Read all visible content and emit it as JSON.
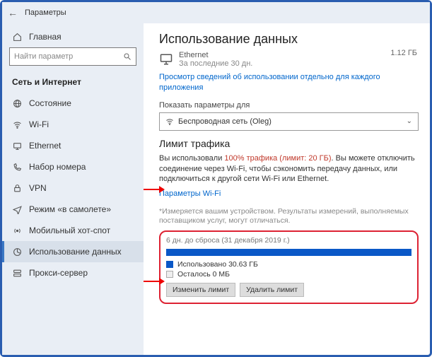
{
  "titlebar": {
    "label": "Параметры"
  },
  "sidebar": {
    "home": "Главная",
    "search_placeholder": "Найти параметр",
    "section": "Сеть и Интернет",
    "items": [
      {
        "label": "Состояние"
      },
      {
        "label": "Wi-Fi"
      },
      {
        "label": "Ethernet"
      },
      {
        "label": "Набор номера"
      },
      {
        "label": "VPN"
      },
      {
        "label": "Режим «в самолете»"
      },
      {
        "label": "Мобильный хот-спот"
      },
      {
        "label": "Использование данных"
      },
      {
        "label": "Прокси-сервер"
      }
    ]
  },
  "main": {
    "title": "Использование данных",
    "eth_name": "Ethernet",
    "eth_sub": "За последние 30 дн.",
    "total": "1.12 ГБ",
    "link_per_app": "Просмотр сведений об использовании отдельно для каждого приложения",
    "show_for": "Показать параметры для",
    "dropdown_value": "Беспроводная сеть (Oleg)",
    "limit_head": "Лимит трафика",
    "used_prefix": "Вы использовали ",
    "used_red": "100% трафика (лимит: 20 ГБ)",
    "used_suffix": ".  Вы можете отключить соединение через Wi-Fi, чтобы сэкономить передачу данных, или подключиться к другой сети Wi-Fi или Ethernet.",
    "wifi_params": "Параметры Wi-Fi",
    "footnote": "*Измеряется вашим устройством. Результаты измерений, выполняемых поставщиком услуг, могут отличаться.",
    "reset": "6 дн. до сброса (31 декабря 2019 г.)",
    "used_legend": "Использовано 30.63 ГБ",
    "left_legend": "Осталось 0 МБ",
    "btn_change": "Изменить лимит",
    "btn_delete": "Удалить лимит"
  }
}
